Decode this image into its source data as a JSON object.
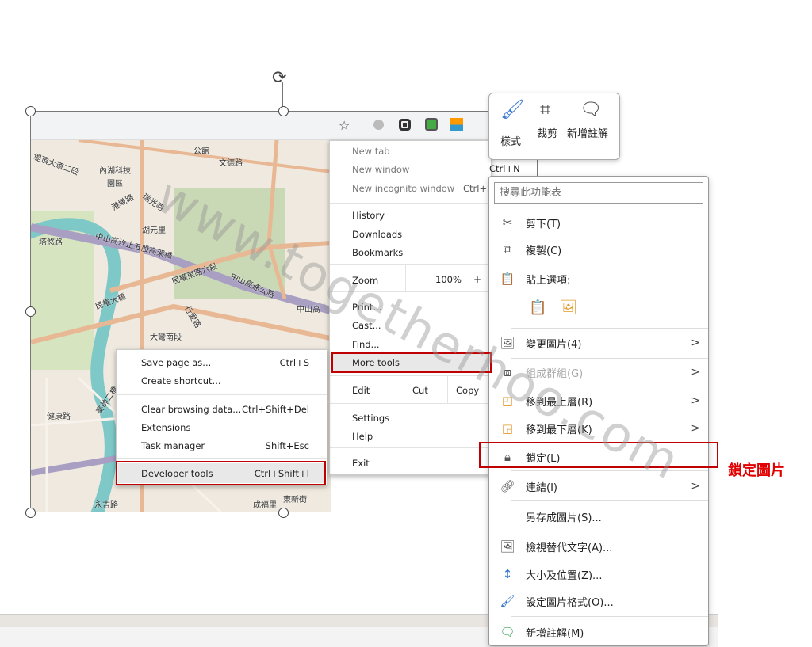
{
  "watermark": "www.togetherhoo.com",
  "colors": {
    "highlight_box": "#c00000",
    "annotation": "#e00000"
  },
  "mini_toolbar": {
    "style": "樣式",
    "crop": "裁剪",
    "new_comment": "新增註解"
  },
  "map_labels": [
    "堤頂大道二段",
    "內湖科技",
    "園區",
    "文德路",
    "港墘路",
    "瑞光路",
    "湖元里",
    "中山高汐止五股高架橋",
    "塔悠路",
    "民權東路六段",
    "中山高速公路",
    "中山高",
    "民權大橋",
    "行愛路",
    "大彎南段",
    "健康路",
    "永吉路",
    "成福里",
    "東新街",
    "麥帥二橋",
    "公館"
  ],
  "chrome_menu": {
    "new_tab": "New tab",
    "new_window": "New window",
    "new_window_shortcut": "Ctrl+N",
    "incognito": "New incognito window",
    "incognito_shortcut": "Ctrl+S",
    "history": "History",
    "downloads": "Downloads",
    "bookmarks": "Bookmarks",
    "zoom": "Zoom",
    "zoom_minus": "-",
    "zoom_value": "100%",
    "zoom_plus": "+",
    "print": "Print...",
    "cast": "Cast...",
    "find": "Find...",
    "more_tools": "More tools",
    "edit": "Edit",
    "cut": "Cut",
    "copy": "Copy",
    "settings": "Settings",
    "help": "Help",
    "exit": "Exit"
  },
  "more_tools_menu": [
    {
      "label": "Save page as...",
      "shortcut": "Ctrl+S"
    },
    {
      "label": "Create shortcut...",
      "shortcut": ""
    },
    {
      "label": "Clear browsing data...",
      "shortcut": "Ctrl+Shift+Del"
    },
    {
      "label": "Extensions",
      "shortcut": ""
    },
    {
      "label": "Task manager",
      "shortcut": "Shift+Esc"
    },
    {
      "label": "Developer tools",
      "shortcut": "Ctrl+Shift+I"
    }
  ],
  "context_menu": {
    "search_placeholder": "搜尋此功能表",
    "cut": "剪下(T)",
    "copy": "複製(C)",
    "paste_options": "貼上選項:",
    "change_picture": "變更圖片(4)",
    "group": "組成群組(G)",
    "bring_front": "移到最上層(R)",
    "send_back": "移到最下層(K)",
    "lock": "鎖定(L)",
    "link": "連結(I)",
    "save_as_picture": "另存成圖片(S)...",
    "alt_text": "檢視替代文字(A)...",
    "size_position": "大小及位置(Z)...",
    "format_picture": "設定圖片格式(O)...",
    "new_comment": "新增註解(M)"
  },
  "annotation": "鎖定圖片"
}
